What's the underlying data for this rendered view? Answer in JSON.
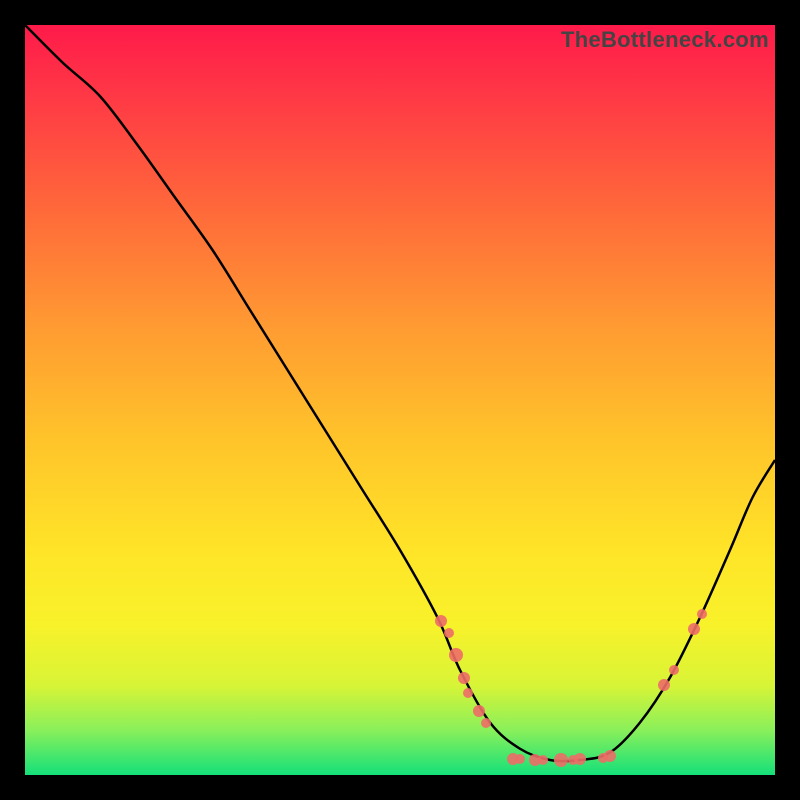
{
  "watermark": "TheBottleneck.com",
  "colors": {
    "gradient_top": "#ff1a4a",
    "gradient_mid": "#ffe428",
    "gradient_bottom": "#14e07a",
    "curve": "#000000",
    "marker": "#ed6d67"
  },
  "chart_data": {
    "type": "line",
    "title": "",
    "xlabel": "",
    "ylabel": "",
    "xlim": [
      0,
      100
    ],
    "ylim": [
      0,
      100
    ],
    "series": [
      {
        "name": "bottleneck-curve",
        "x": [
          0,
          5,
          10,
          15,
          20,
          25,
          30,
          35,
          40,
          45,
          50,
          55,
          58,
          62,
          66,
          70,
          74,
          78,
          82,
          86,
          90,
          94,
          97,
          100
        ],
        "y": [
          100,
          95,
          90.5,
          84,
          77,
          70,
          62,
          54,
          46,
          38,
          30,
          21,
          14,
          7,
          3.5,
          2,
          2,
          3,
          7,
          13,
          21,
          30,
          37,
          42
        ]
      }
    ],
    "markers": [
      {
        "x": 55.5,
        "y": 20.5,
        "r": 6
      },
      {
        "x": 56.5,
        "y": 19,
        "r": 5
      },
      {
        "x": 57.5,
        "y": 16,
        "r": 7
      },
      {
        "x": 58.5,
        "y": 13,
        "r": 6
      },
      {
        "x": 59,
        "y": 11,
        "r": 5
      },
      {
        "x": 60.5,
        "y": 8.5,
        "r": 6
      },
      {
        "x": 61.5,
        "y": 7,
        "r": 5
      },
      {
        "x": 65,
        "y": 2.2,
        "r": 6
      },
      {
        "x": 66,
        "y": 2.1,
        "r": 5
      },
      {
        "x": 68,
        "y": 2,
        "r": 6
      },
      {
        "x": 69,
        "y": 2,
        "r": 5
      },
      {
        "x": 71.5,
        "y": 2,
        "r": 7
      },
      {
        "x": 73,
        "y": 2,
        "r": 5
      },
      {
        "x": 74,
        "y": 2.1,
        "r": 6
      },
      {
        "x": 77,
        "y": 2.3,
        "r": 5
      },
      {
        "x": 78,
        "y": 2.6,
        "r": 6
      },
      {
        "x": 85.2,
        "y": 12,
        "r": 6
      },
      {
        "x": 86.5,
        "y": 14,
        "r": 5
      },
      {
        "x": 89.2,
        "y": 19.5,
        "r": 6
      },
      {
        "x": 90.2,
        "y": 21.5,
        "r": 5
      }
    ]
  }
}
